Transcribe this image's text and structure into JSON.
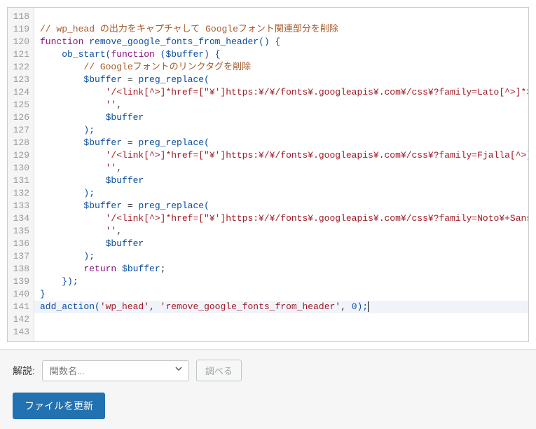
{
  "editor": {
    "startLine": 118,
    "activeLine": 142,
    "lines": [
      {
        "tokens": []
      },
      {
        "tokens": [
          {
            "t": "// wp_head の出力をキャプチャして Googleフォント関連部分を削除",
            "c": "tok-comment"
          }
        ]
      },
      {
        "tokens": [
          {
            "t": "function",
            "c": "tok-keyword"
          },
          {
            "t": " ",
            "c": ""
          },
          {
            "t": "remove_google_fonts_from_header",
            "c": "tok-func"
          },
          {
            "t": "() {",
            "c": "tok-paren"
          }
        ]
      },
      {
        "tokens": [
          {
            "t": "    ",
            "c": ""
          },
          {
            "t": "ob_start",
            "c": "tok-func"
          },
          {
            "t": "(",
            "c": "tok-paren"
          },
          {
            "t": "function",
            "c": "tok-keyword"
          },
          {
            "t": " (",
            "c": "tok-paren"
          },
          {
            "t": "$buffer",
            "c": "tok-var"
          },
          {
            "t": ") {",
            "c": "tok-paren"
          }
        ]
      },
      {
        "tokens": [
          {
            "t": "        ",
            "c": ""
          },
          {
            "t": "// Googleフォントのリンクタグを削除",
            "c": "tok-comment"
          }
        ]
      },
      {
        "tokens": [
          {
            "t": "        ",
            "c": ""
          },
          {
            "t": "$buffer",
            "c": "tok-var"
          },
          {
            "t": " = ",
            "c": "tok-punct"
          },
          {
            "t": "preg_replace",
            "c": "tok-func"
          },
          {
            "t": "(",
            "c": "tok-paren"
          }
        ]
      },
      {
        "tokens": [
          {
            "t": "            ",
            "c": ""
          },
          {
            "t": "'/<link[^>]*href=[\"¥']https:¥/¥/fonts¥.googleapis¥.com¥/css¥?family=Lato[^>]*>[¥n]*/'",
            "c": "tok-string"
          },
          {
            "t": ",",
            "c": "tok-punct"
          }
        ]
      },
      {
        "tokens": [
          {
            "t": "            ",
            "c": ""
          },
          {
            "t": "''",
            "c": "tok-string"
          },
          {
            "t": ",",
            "c": "tok-punct"
          }
        ]
      },
      {
        "tokens": [
          {
            "t": "            ",
            "c": ""
          },
          {
            "t": "$buffer",
            "c": "tok-var"
          }
        ]
      },
      {
        "tokens": [
          {
            "t": "        ",
            "c": ""
          },
          {
            "t": ");",
            "c": "tok-paren"
          }
        ]
      },
      {
        "tokens": [
          {
            "t": "        ",
            "c": ""
          },
          {
            "t": "$buffer",
            "c": "tok-var"
          },
          {
            "t": " = ",
            "c": "tok-punct"
          },
          {
            "t": "preg_replace",
            "c": "tok-func"
          },
          {
            "t": "(",
            "c": "tok-paren"
          }
        ]
      },
      {
        "tokens": [
          {
            "t": "            ",
            "c": ""
          },
          {
            "t": "'/<link[^>]*href=[\"¥']https:¥/¥/fonts¥.googleapis¥.com¥/css¥?family=Fjalla[^>]*>[¥n]*/'",
            "c": "tok-string"
          },
          {
            "t": ",",
            "c": "tok-punct"
          }
        ]
      },
      {
        "tokens": [
          {
            "t": "            ",
            "c": ""
          },
          {
            "t": "''",
            "c": "tok-string"
          },
          {
            "t": ",",
            "c": "tok-punct"
          }
        ]
      },
      {
        "tokens": [
          {
            "t": "            ",
            "c": ""
          },
          {
            "t": "$buffer",
            "c": "tok-var"
          }
        ]
      },
      {
        "tokens": [
          {
            "t": "        ",
            "c": ""
          },
          {
            "t": ");",
            "c": "tok-paren"
          }
        ]
      },
      {
        "tokens": [
          {
            "t": "        ",
            "c": ""
          },
          {
            "t": "$buffer",
            "c": "tok-var"
          },
          {
            "t": " = ",
            "c": "tok-punct"
          },
          {
            "t": "preg_replace",
            "c": "tok-func"
          },
          {
            "t": "(",
            "c": "tok-paren"
          }
        ]
      },
      {
        "tokens": [
          {
            "t": "            ",
            "c": ""
          },
          {
            "t": "'/<link[^>]*href=[\"¥']https:¥/¥/fonts¥.googleapis¥.com¥/css¥?family=Noto¥+Sans¥+JP[^>]*>[¥n]*/'",
            "c": "tok-string"
          },
          {
            "t": ",",
            "c": "tok-punct"
          }
        ]
      },
      {
        "tokens": [
          {
            "t": "            ",
            "c": ""
          },
          {
            "t": "''",
            "c": "tok-string"
          },
          {
            "t": ",",
            "c": "tok-punct"
          }
        ]
      },
      {
        "tokens": [
          {
            "t": "            ",
            "c": ""
          },
          {
            "t": "$buffer",
            "c": "tok-var"
          }
        ]
      },
      {
        "tokens": [
          {
            "t": "        ",
            "c": ""
          },
          {
            "t": ");",
            "c": "tok-paren"
          }
        ]
      },
      {
        "tokens": [
          {
            "t": "",
            "c": ""
          }
        ]
      },
      {
        "tokens": [
          {
            "t": "        ",
            "c": ""
          },
          {
            "t": "return",
            "c": "tok-keyword"
          },
          {
            "t": " ",
            "c": ""
          },
          {
            "t": "$buffer",
            "c": "tok-var"
          },
          {
            "t": ";",
            "c": "tok-punct"
          }
        ]
      },
      {
        "tokens": [
          {
            "t": "    ",
            "c": ""
          },
          {
            "t": "});",
            "c": "tok-paren"
          }
        ]
      },
      {
        "tokens": [
          {
            "t": "}",
            "c": "tok-paren"
          }
        ]
      },
      {
        "tokens": [
          {
            "t": "add_action",
            "c": "tok-func"
          },
          {
            "t": "(",
            "c": "tok-paren"
          },
          {
            "t": "'wp_head'",
            "c": "tok-string"
          },
          {
            "t": ", ",
            "c": "tok-punct"
          },
          {
            "t": "'remove_google_fonts_from_header'",
            "c": "tok-string"
          },
          {
            "t": ", ",
            "c": "tok-punct"
          },
          {
            "t": "0",
            "c": "tok-num"
          },
          {
            "t": ");",
            "c": "tok-paren"
          }
        ],
        "cursor": true
      },
      {
        "tokens": [
          {
            "t": "",
            "c": ""
          }
        ]
      }
    ]
  },
  "panel": {
    "label": "解説:",
    "selectPlaceholder": "関数名...",
    "lookupButton": "調べる",
    "updateButton": "ファイルを更新"
  }
}
